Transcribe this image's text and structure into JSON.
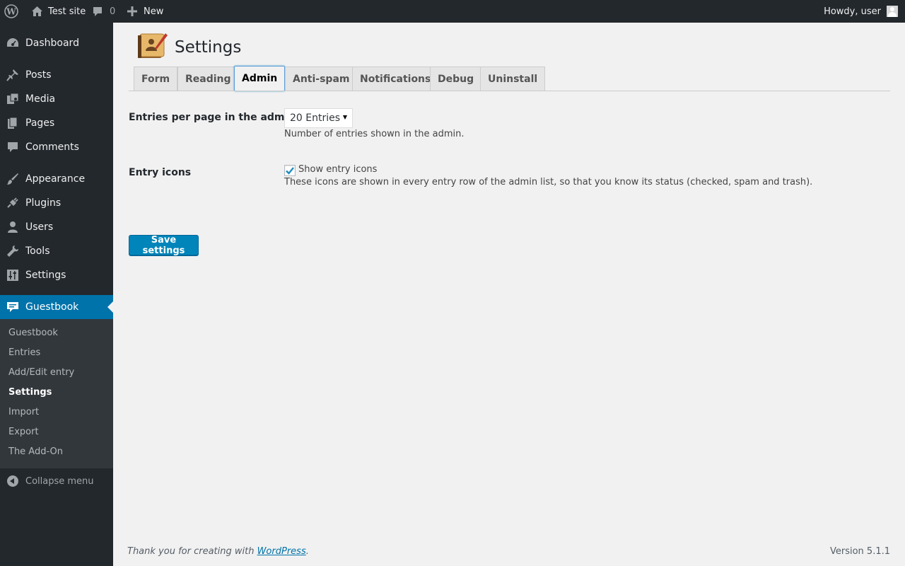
{
  "admin_bar": {
    "site_name": "Test site",
    "comments_count": "0",
    "new_label": "New",
    "howdy": "Howdy, user"
  },
  "sidebar": {
    "items": [
      {
        "label": "Dashboard",
        "icon": "dashboard-icon"
      },
      {
        "label": "Posts",
        "icon": "pushpin-icon"
      },
      {
        "label": "Media",
        "icon": "media-icon"
      },
      {
        "label": "Pages",
        "icon": "pages-icon"
      },
      {
        "label": "Comments",
        "icon": "comment-icon"
      },
      {
        "label": "Appearance",
        "icon": "brush-icon"
      },
      {
        "label": "Plugins",
        "icon": "plugin-icon"
      },
      {
        "label": "Users",
        "icon": "user-icon"
      },
      {
        "label": "Tools",
        "icon": "wrench-icon"
      },
      {
        "label": "Settings",
        "icon": "sliders-icon"
      },
      {
        "label": "Guestbook",
        "icon": "guestbook-icon"
      }
    ],
    "submenu": [
      "Guestbook",
      "Entries",
      "Add/Edit entry",
      "Settings",
      "Import",
      "Export",
      "The Add-On"
    ],
    "collapse_label": "Collapse menu"
  },
  "page": {
    "title": "Settings",
    "tabs": [
      "Form",
      "Reading",
      "Admin",
      "Anti-spam",
      "Notifications",
      "Debug",
      "Uninstall"
    ],
    "active_tab": "Admin"
  },
  "settings": {
    "entries_per_page_label": "Entries per page in the admin",
    "entries_per_page_value": "20 Entries",
    "entries_per_page_desc": "Number of entries shown in the admin.",
    "entry_icons_label": "Entry icons",
    "entry_icons_checkbox": "Show entry icons",
    "entry_icons_checked": true,
    "entry_icons_desc": "These icons are shown in every entry row of the admin list, so that you know its status (checked, spam and trash).",
    "save_button": "Save settings"
  },
  "footer": {
    "thanks_prefix": "Thank you for creating with ",
    "thanks_link": "WordPress",
    "thanks_suffix": ".",
    "version": "Version 5.1.1"
  },
  "colors": {
    "admin_bar_bg": "#23282d",
    "accent": "#0073aa",
    "button_primary": "#0085ba"
  }
}
